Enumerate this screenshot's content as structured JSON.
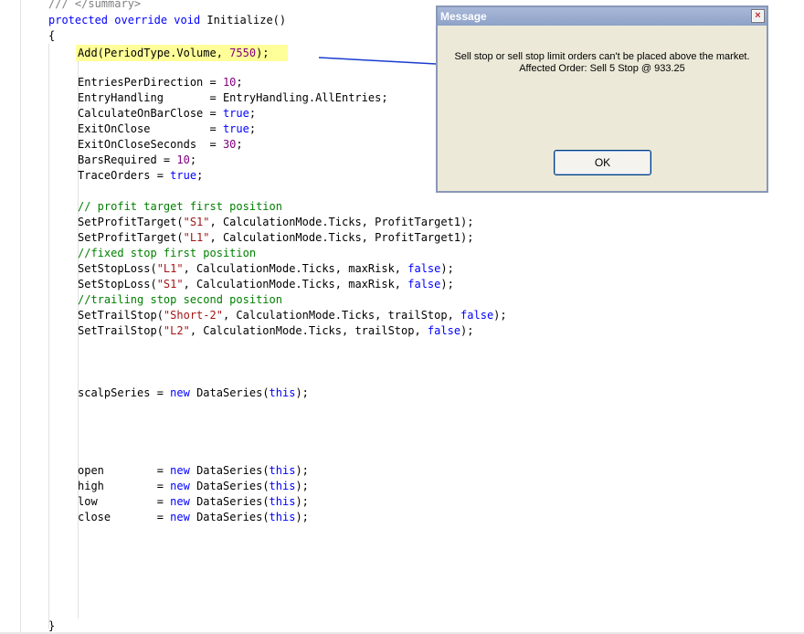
{
  "code": {
    "summary": "/// </summary>",
    "signature_kw1": "protected",
    "signature_kw2": "override",
    "signature_kw3": "void",
    "signature_rest": " Initialize()",
    "open_brace": "{",
    "close_brace": "}",
    "add_call_a": "Add(PeriodType.Volume, ",
    "add_call_num": "7550",
    "add_call_b": ");",
    "entries_a": "EntriesPerDirection = ",
    "entries_num": "10",
    "entry_handling": "EntryHandling       = EntryHandling.AllEntries;",
    "calc_a": "CalculateOnBarClose = ",
    "exit_a": "ExitOnClose         = ",
    "exitsec_a": "ExitOnCloseSeconds  = ",
    "exitsec_num": "30",
    "bars_a": "BarsRequired = ",
    "bars_num": "10",
    "trace_a": "TraceOrders = ",
    "true_kw": "true",
    "false_kw": "false",
    "semicolon": ";",
    "comment_profit": "// profit target first position",
    "profit1_a": "SetProfitTarget(",
    "profit1_s": "\"S1\"",
    "profit_b": ", CalculationMode.Ticks, ProfitTarget1);",
    "profit2_s": "\"L1\"",
    "comment_fixed": "//fixed stop first position",
    "stop_a": "SetStopLoss(",
    "stop1_s": "\"L1\"",
    "stop2_s": "\"S1\"",
    "stop_b": ", CalculationMode.Ticks, maxRisk, ",
    "stop_c": ");",
    "comment_trail": "//trailing stop second position",
    "trail_a": "SetTrailStop(",
    "trail1_s": "\"Short-2\"",
    "trail2_s": "\"L2\"",
    "trail_b": ", CalculationMode.Ticks, trailStop, ",
    "trail_c": ");",
    "scalp_a": "scalpSeries = ",
    "new_kw": "new",
    "ds_a": " DataSeries(",
    "this_kw": "this",
    "ds_b": ");",
    "open_a": "open        = ",
    "high_a": "high        = ",
    "low_a": "low         = ",
    "close_a": "close       = "
  },
  "dialog": {
    "title": "Message",
    "close_glyph": "×",
    "line1": "Sell stop or sell stop limit orders can't be placed above the market.",
    "line2": "Affected Order: Sell 5 Stop @ 933.25",
    "ok_label": "OK"
  },
  "colors": {
    "keyword": "#0000ff",
    "string": "#a31515",
    "number": "#800080",
    "comment": "#008000",
    "highlight": "#ffff99",
    "dialog_bg": "#ece9d8",
    "arrow": "#1a3ccf"
  }
}
